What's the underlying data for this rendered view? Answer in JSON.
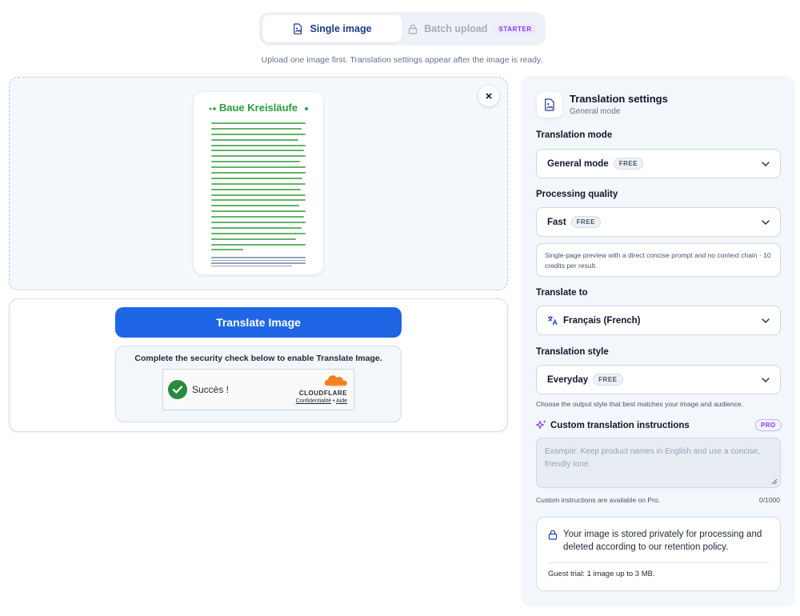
{
  "tabs": {
    "single": "Single image",
    "batch": "Batch upload",
    "batch_badge": "STARTER"
  },
  "hint": "Upload one image first. Translation settings appear after the image is ready.",
  "preview": {
    "title": "Baue Kreisläufe"
  },
  "actions": {
    "translate_label": "Translate Image",
    "security_text": "Complete the security check below to enable Translate Image.",
    "turnstile_status": "Succès !",
    "cloudflare": "CLOUDFLARE",
    "privacy_link": "Confidentialité",
    "help_link": "Aide"
  },
  "settings": {
    "title": "Translation settings",
    "subtitle": "General mode",
    "mode_label": "Translation mode",
    "mode_value": "General mode",
    "quality_label": "Processing quality",
    "quality_value": "Fast",
    "quality_note": "Single-page preview with a direct concise prompt and no context chain · 10 credits per result.",
    "translate_to_label": "Translate to",
    "translate_to_value": "Français (French)",
    "style_label": "Translation style",
    "style_value": "Everyday",
    "style_note": "Choose the output style that best matches your image and audience.",
    "free_badge": "FREE",
    "custom_label": "Custom translation instructions",
    "pro_badge": "PRO",
    "custom_placeholder": "Example: Keep product names in English and use a concise, friendly tone.",
    "custom_note": "Custom instructions are available on Pro.",
    "custom_counter": "0/1000",
    "privacy_text": "Your image is stored privately for processing and deleted according to our retention policy.",
    "guest_text": "Guest trial: 1 image up to 3 MB."
  },
  "colors": {
    "primary": "#1e66e6",
    "pro": "#7c3aed",
    "success": "#2a8a3f",
    "cloudflare": "#f38020"
  }
}
